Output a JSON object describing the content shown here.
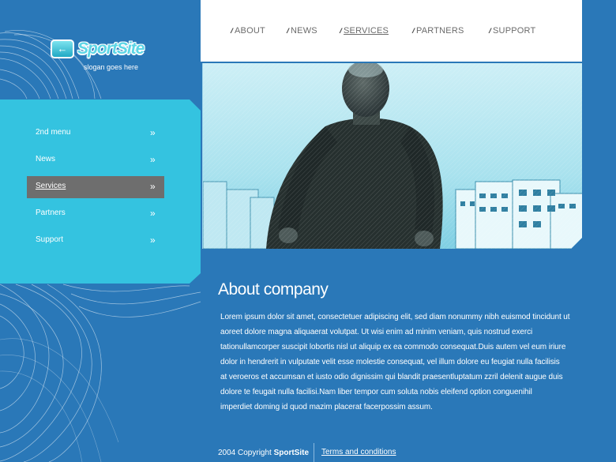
{
  "logo": {
    "badge_glyph": "←",
    "name": "SportSite",
    "slogan": "slogan goes here"
  },
  "topnav": [
    {
      "label": "ABOUT",
      "active": false
    },
    {
      "label": "NEWS",
      "active": false
    },
    {
      "label": "SERVICES",
      "active": true
    },
    {
      "label": "PARTNERS",
      "active": false
    },
    {
      "label": "SUPPORT",
      "active": false
    }
  ],
  "topnav_arrow": "//",
  "sidebar": [
    {
      "label": "2nd menu",
      "active": false
    },
    {
      "label": "News",
      "active": false
    },
    {
      "label": "Services",
      "active": true
    },
    {
      "label": "Partners",
      "active": false
    },
    {
      "label": "Support",
      "active": false
    }
  ],
  "sidebar_chevron": "»",
  "about": {
    "title": "About company",
    "lines": [
      "Lorem ipsum dolor sit amet, consectetuer adipiscing elit, sed diam nonummy nibh euismod tincidunt ut",
      "aoreet dolore magna aliquaerat volutpat. Ut wisi enim ad minim veniam, quis nostrud exerci",
      "tationullamcorper suscipit lobortis nisl ut aliquip ex ea commodo consequat.Duis autem vel eum iriure",
      "dolor in hendrerit in vulputate velit esse molestie consequat, vel illum dolore eu feugiat nulla facilisis",
      "at veroeros et accumsan et iusto odio dignissim qui blandit praesentluptatum zzril delenit augue duis",
      "dolore te feugait nulla facilisi.Nam liber tempor cum soluta nobis eleifend option conguenihil",
      "imperdiet doming id quod mazim placerat facerpossim assum."
    ]
  },
  "footer": {
    "copy_prefix": "2004 Copyright",
    "copy_brand": "SportSite",
    "terms_link": "Terms and conditions"
  },
  "colors": {
    "page_bg": "#2a78b8",
    "sidebar_bg": "#34c3e0",
    "active_bg": "#6e6e6e",
    "topnav_bg": "#ffffff"
  }
}
